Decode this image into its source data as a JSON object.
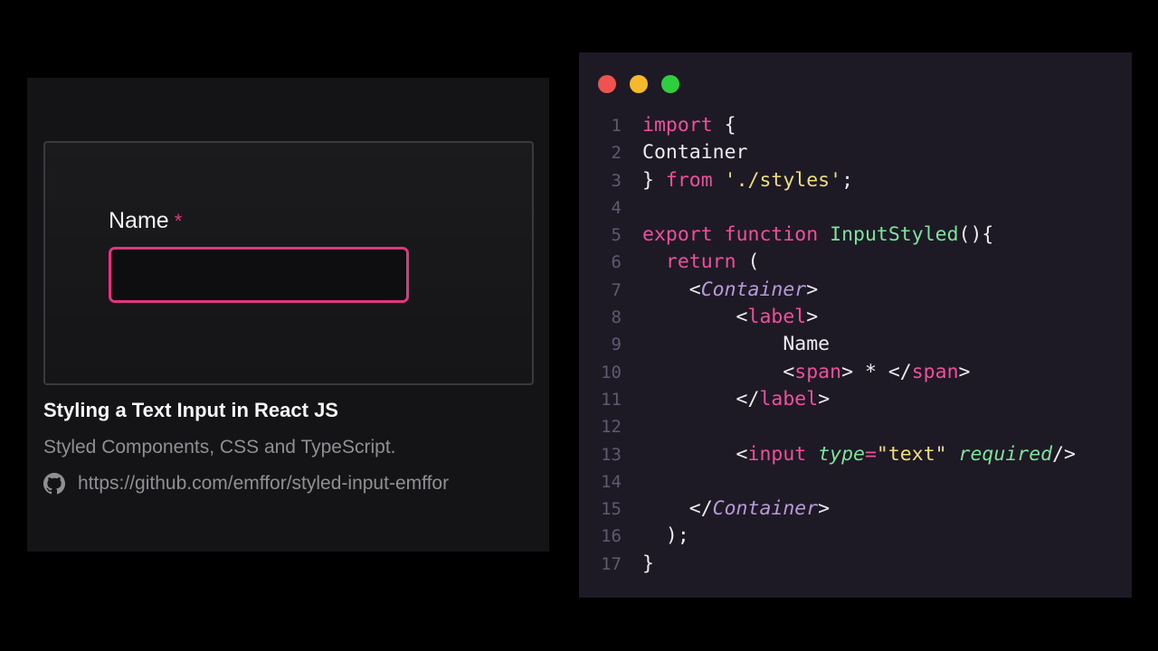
{
  "card": {
    "field_label": "Name",
    "required_mark": "*",
    "input_value": "",
    "title": "Styling a Text Input in React JS",
    "subtitle": "Styled Components, CSS and TypeScript.",
    "link": "https://github.com/emffor/styled-input-emffor",
    "icon": "github-icon"
  },
  "editor": {
    "window_controls": [
      "red",
      "yellow",
      "green"
    ],
    "lines": [
      {
        "n": "1",
        "tokens": [
          [
            "kw",
            "import"
          ],
          [
            "tx",
            " {"
          ]
        ]
      },
      {
        "n": "2",
        "tokens": [
          [
            "tx",
            "Container"
          ]
        ]
      },
      {
        "n": "3",
        "tokens": [
          [
            "tx",
            "} "
          ],
          [
            "kw",
            "from"
          ],
          [
            "tx",
            " "
          ],
          [
            "str",
            "'./styles'"
          ],
          [
            "tx",
            ";"
          ]
        ]
      },
      {
        "n": "4",
        "tokens": []
      },
      {
        "n": "5",
        "tokens": [
          [
            "kw",
            "export"
          ],
          [
            "tx",
            " "
          ],
          [
            "kw",
            "function"
          ],
          [
            "tx",
            " "
          ],
          [
            "fn",
            "InputStyled"
          ],
          [
            "tx",
            "(){"
          ]
        ]
      },
      {
        "n": "6",
        "tokens": [
          [
            "tx",
            "  "
          ],
          [
            "kw",
            "return"
          ],
          [
            "tx",
            " ("
          ]
        ]
      },
      {
        "n": "7",
        "tokens": [
          [
            "tx",
            "    <"
          ],
          [
            "comp",
            "Container"
          ],
          [
            "tx",
            ">"
          ]
        ]
      },
      {
        "n": "8",
        "tokens": [
          [
            "tx",
            "        <"
          ],
          [
            "tag",
            "label"
          ],
          [
            "tx",
            ">"
          ]
        ]
      },
      {
        "n": "9",
        "tokens": [
          [
            "tx",
            "            Name"
          ]
        ]
      },
      {
        "n": "10",
        "tokens": [
          [
            "tx",
            "            <"
          ],
          [
            "tag",
            "span"
          ],
          [
            "tx",
            "> * </"
          ],
          [
            "tag",
            "span"
          ],
          [
            "tx",
            ">"
          ]
        ]
      },
      {
        "n": "11",
        "tokens": [
          [
            "tx",
            "        </"
          ],
          [
            "tag",
            "label"
          ],
          [
            "tx",
            ">"
          ]
        ]
      },
      {
        "n": "12",
        "tokens": []
      },
      {
        "n": "13",
        "tokens": [
          [
            "tx",
            "        <"
          ],
          [
            "tag",
            "input"
          ],
          [
            "tx",
            " "
          ],
          [
            "attr",
            "type"
          ],
          [
            "kw",
            "="
          ],
          [
            "str",
            "\"text\""
          ],
          [
            "tx",
            " "
          ],
          [
            "attr",
            "required"
          ],
          [
            "tx",
            "/>"
          ]
        ]
      },
      {
        "n": "14",
        "tokens": []
      },
      {
        "n": "15",
        "tokens": [
          [
            "tx",
            "    </"
          ],
          [
            "comp",
            "Container"
          ],
          [
            "tx",
            ">"
          ]
        ]
      },
      {
        "n": "16",
        "tokens": [
          [
            "tx",
            "  );"
          ]
        ]
      },
      {
        "n": "17",
        "tokens": [
          [
            "tx",
            "}"
          ]
        ]
      }
    ]
  }
}
